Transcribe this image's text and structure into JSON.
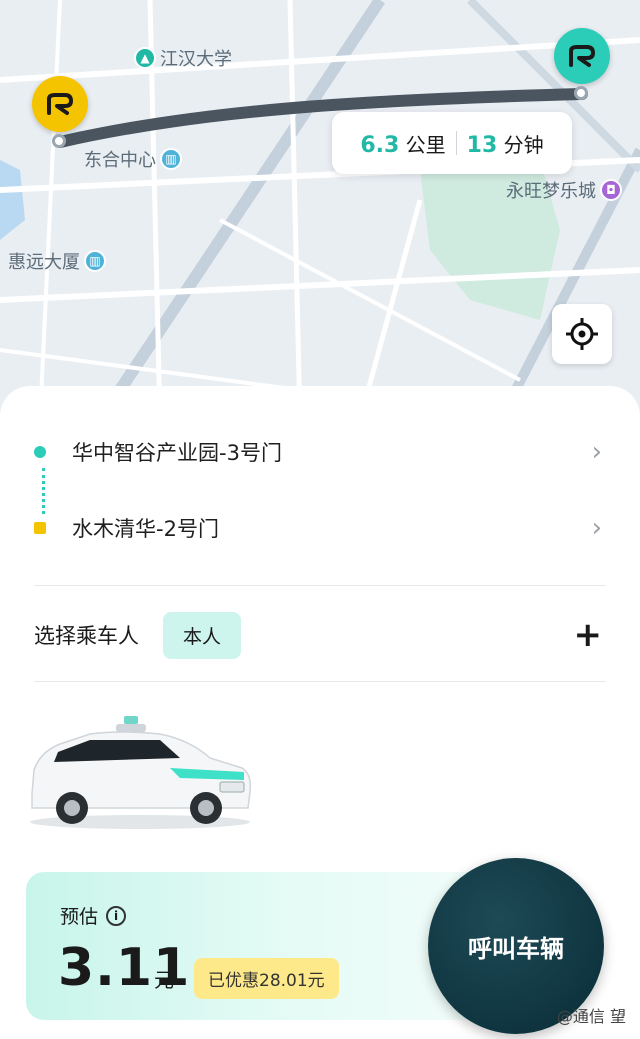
{
  "map": {
    "pois": {
      "jianghan": "江汉大学",
      "donghe": "东合中心",
      "huiyuan": "惠远大厦",
      "yongwang": "永旺梦乐城"
    },
    "route": {
      "distance": "6.3",
      "distance_unit": "公里",
      "duration": "13",
      "duration_unit": "分钟"
    }
  },
  "trip": {
    "origin": "华中智谷产业园-3号门",
    "destination": "水木清华-2号门"
  },
  "passenger": {
    "label": "选择乘车人",
    "selected": "本人"
  },
  "fare": {
    "label": "预估",
    "price": "3.11",
    "unit": "元",
    "discount": "已优惠28.01元"
  },
  "actions": {
    "call": "呼叫车辆"
  },
  "watermark": "@通信 望",
  "colors": {
    "accent": "#21b8a6",
    "origin_marker": "#2ccdb8",
    "destination_marker": "#f5c400",
    "call_button": "#0f3540"
  }
}
